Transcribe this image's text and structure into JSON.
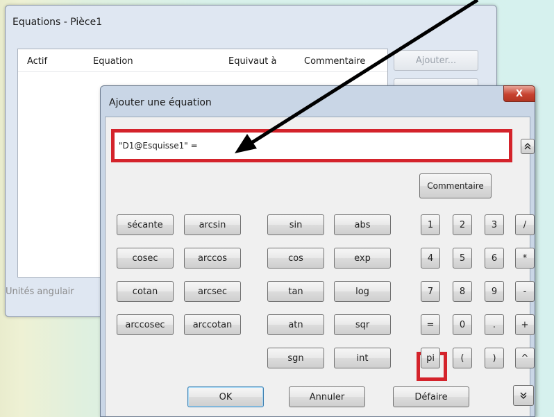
{
  "background_window": {
    "title": "Equations - Pièce1",
    "columns": [
      "Actif",
      "Equation",
      "Equivaut à",
      "Commentaire"
    ],
    "add_button": "Ajouter...",
    "angular_units_label": "Unités angulair"
  },
  "dialog": {
    "title": "Ajouter une équation",
    "close_label": "X",
    "equation_value": "\"D1@Esquisse1\" = ",
    "collapse_icon": "chevron-double-up-icon",
    "comment_button": "Commentaire",
    "functions": [
      [
        "sécante",
        "arcsin",
        "sin",
        "abs"
      ],
      [
        "cosec",
        "arccos",
        "cos",
        "exp"
      ],
      [
        "cotan",
        "arcsec",
        "tan",
        "log"
      ],
      [
        "arccosec",
        "arccotan",
        "atn",
        "sqr"
      ]
    ],
    "functions_last_row": [
      "sgn",
      "int"
    ],
    "keypad": [
      [
        "1",
        "2",
        "3",
        "/"
      ],
      [
        "4",
        "5",
        "6",
        "*"
      ],
      [
        "7",
        "8",
        "9",
        "-"
      ],
      [
        "=",
        "0",
        ".",
        "+"
      ],
      [
        "pi",
        "(",
        ")",
        "^"
      ]
    ],
    "ok_button": "OK",
    "cancel_button": "Annuler",
    "undo_button": "Défaire",
    "expand_icon": "chevron-double-down-icon",
    "highlight_color": "#d4232b"
  }
}
